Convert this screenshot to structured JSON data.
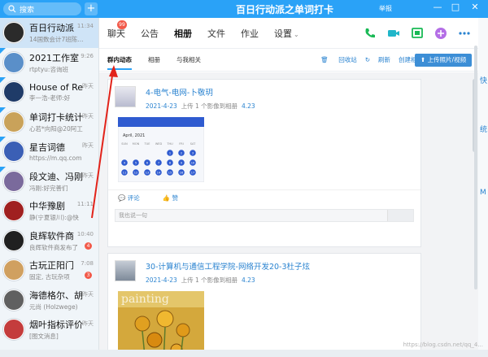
{
  "window": {
    "title": "百日行动派之单词打卡",
    "search_label": "搜索",
    "report_label": "举报",
    "controls": [
      "—",
      "□",
      "✕"
    ]
  },
  "chats": [
    {
      "name": "百日行动派",
      "preview": "14国数会计7班陈...",
      "time": "11:34",
      "active": true,
      "avatar_color": "#2b2b2b"
    },
    {
      "name": "2021工作室",
      "preview": "rtptyu:咨询班",
      "time": "9:26",
      "avatar_color": "#5a8fc9"
    },
    {
      "name": "House of Re",
      "preview": "李一浩-老师:好",
      "time": "昨天",
      "avatar_color": "#1f3b68"
    },
    {
      "name": "单词打卡统计",
      "preview": "心若*向阳@20阿工",
      "time": "昨天",
      "avatar_color": "#c9a25a"
    },
    {
      "name": "星吉词德",
      "preview": "https://m.qq.com",
      "time": "昨天",
      "avatar_color": "#3b5fb5"
    },
    {
      "name": "段文迪、冯刚",
      "preview": "冯刚:好完善们",
      "time": "昨天",
      "avatar_color": "#7a6a9c"
    },
    {
      "name": "中华豫剧",
      "preview": "静(宁夏银川):@快",
      "time": "11:11",
      "avatar_color": "#a02020"
    },
    {
      "name": "良辉软件商",
      "preview": "良辉软件商发布了",
      "time": "10:40",
      "badge": "4",
      "avatar_color": "#202020"
    },
    {
      "name": "古玩正阳门",
      "preview": "固定, 古玩杂项",
      "time": "7:08",
      "badge": "3",
      "avatar_color": "#d0a060"
    },
    {
      "name": "海德格尔、胡",
      "preview": "元尚 (Holzwege)",
      "time": "昨天",
      "avatar_color": "#606060"
    },
    {
      "name": "烟叶指标评价",
      "preview": "[图文消息]",
      "time": "昨天",
      "avatar_color": "#c43c3c"
    }
  ],
  "tabs": [
    {
      "label": "聊天",
      "badge": "99"
    },
    {
      "label": "公告"
    },
    {
      "label": "相册",
      "active": true
    },
    {
      "label": "文件"
    },
    {
      "label": "作业"
    },
    {
      "label": "设置",
      "arrow": "⌄"
    }
  ],
  "subtabs": [
    {
      "label": "群内动态",
      "active": true
    },
    {
      "label": "相册"
    },
    {
      "label": "与我相关"
    }
  ],
  "actions": {
    "recycle": "回收站",
    "refresh": "刷新",
    "create_album": "创建相册",
    "upload": "上传照片/视频"
  },
  "posts": [
    {
      "title": "4-电气-电网-卜敬玥",
      "date": "2021-4-23",
      "upload_text": "上传 1 个影像到相册",
      "album": "4.23",
      "image_type": "calendar",
      "calendar": {
        "month": "April, 2021",
        "weekdays": [
          "SUN",
          "MON",
          "TUE",
          "WED",
          "THU",
          "FRI",
          "SAT"
        ],
        "days": [
          "",
          "",
          "",
          "",
          "1",
          "2",
          "3",
          "4",
          "5",
          "6",
          "7",
          "8",
          "9",
          "10",
          "11",
          "12",
          "13",
          "14",
          "15",
          "16",
          "17"
        ]
      },
      "comment_label": "评论",
      "like_label": "赞",
      "comment_placeholder": "我也说一句"
    },
    {
      "title": "30-计算机与通信工程学院-网络开发20-3杜子炫",
      "date": "2021-4-23",
      "upload_text": "上传 1 个影像到相册",
      "album": "4.23",
      "image_type": "painting",
      "painting_text": "painting"
    }
  ],
  "right_strip": [
    "快",
    "M",
    "统"
  ],
  "watermark": "https://blog.csdn.net/qq_4...",
  "colors": {
    "accent": "#2aa2f7",
    "link": "#2a83d0",
    "badge": "#f25a4a",
    "arrow": "#e2231a"
  }
}
